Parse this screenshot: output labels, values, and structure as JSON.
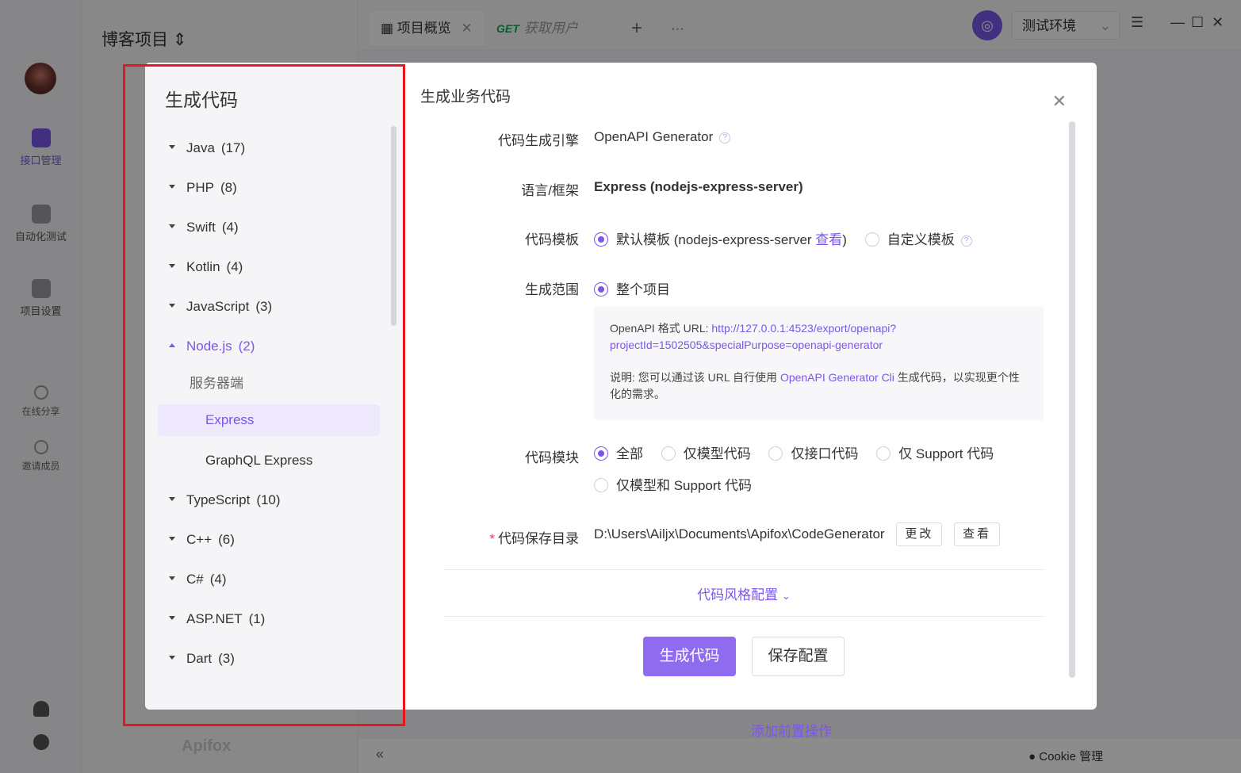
{
  "background": {
    "project_title": "博客项目",
    "rail": {
      "api_mgmt": "接口管理",
      "auto_test": "自动化测试",
      "project_settings": "项目设置",
      "share": "在线分享",
      "invite": "邀请成员"
    },
    "tabs": [
      {
        "label": "项目概览"
      },
      {
        "method": "GET",
        "label": "获取用户"
      }
    ],
    "env": "测试环境",
    "add_pre_op": "添加前置操作",
    "cookie": "Cookie 管理",
    "brand": "Apifox"
  },
  "modal": {
    "tree_title": "生成代码",
    "tree": [
      {
        "label": "Java",
        "count": "(17)"
      },
      {
        "label": "PHP",
        "count": "(8)"
      },
      {
        "label": "Swift",
        "count": "(4)"
      },
      {
        "label": "Kotlin",
        "count": "(4)"
      },
      {
        "label": "JavaScript",
        "count": "(3)"
      },
      {
        "label": "Node.js",
        "count": "(2)"
      },
      {
        "label": "TypeScript",
        "count": "(10)"
      },
      {
        "label": "C++",
        "count": "(6)"
      },
      {
        "label": "C#",
        "count": "(4)"
      },
      {
        "label": "ASP.NET",
        "count": "(1)"
      },
      {
        "label": "Dart",
        "count": "(3)"
      }
    ],
    "tree_group": "服务器端",
    "tree_selected": "Express",
    "tree_other": "GraphQL Express",
    "title": "生成业务代码",
    "engine_label": "代码生成引擎",
    "engine_value": "OpenAPI Generator",
    "lang_label": "语言/框架",
    "lang_value": "Express (nodejs-express-server)",
    "template_label": "代码模板",
    "template_default": "默认模板 (nodejs-express-server",
    "template_view": "查看",
    "template_close": ")",
    "template_custom": "自定义模板",
    "scope_label": "生成范围",
    "scope_value": "整个项目",
    "info_url_label": "OpenAPI 格式 URL: ",
    "info_url_1": "http://127.0.0.1:4523/export/openapi?",
    "info_url_2": "projectId=1502505&specialPurpose=openapi-generator",
    "info_note_pre": "说明: 您可以通过该 URL 自行使用 ",
    "info_note_link": "OpenAPI Generator Cli",
    "info_note_post": " 生成代码，以实现更个性化的需求。",
    "module_label": "代码模块",
    "module_opts": [
      "全部",
      "仅模型代码",
      "仅接口代码",
      "仅 Support 代码",
      "仅模型和 Support 代码"
    ],
    "dir_label": "代码保存目录",
    "dir_value": "D:\\Users\\Ailjx\\Documents\\Apifox\\CodeGenerator",
    "dir_change": "更改",
    "dir_view": "查看",
    "style_config": "代码风格配置",
    "generate_btn": "生成代码",
    "save_btn": "保存配置"
  },
  "colors": {
    "accent": "#7b56e8",
    "highlight_frame": "#e8161e"
  }
}
